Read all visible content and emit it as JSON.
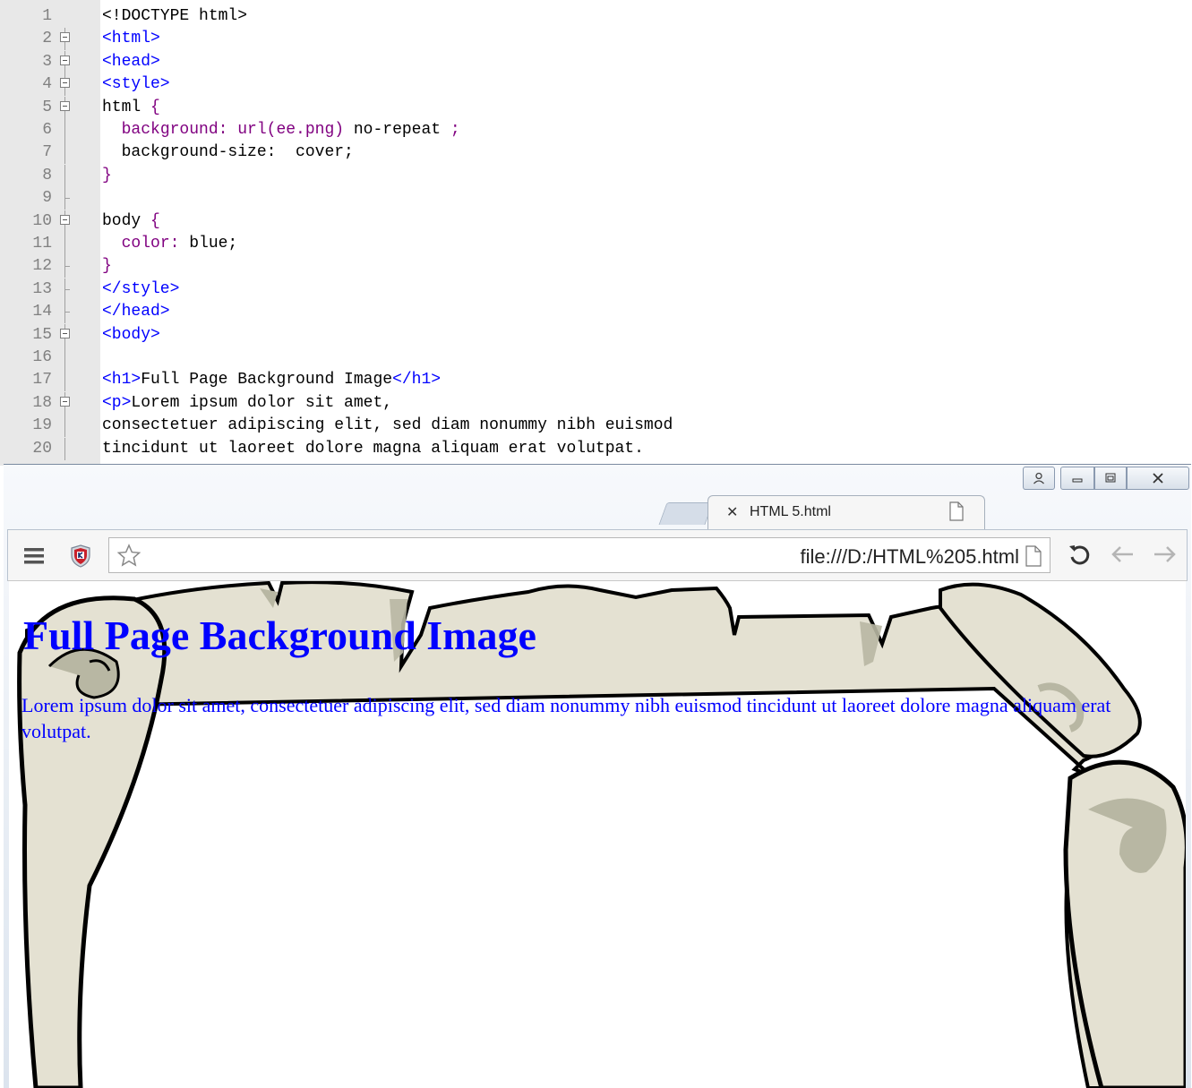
{
  "editor": {
    "lines": [
      {
        "num": "1",
        "fold": "none",
        "segments": [
          {
            "t": "<!DOCTYPE html>",
            "c": "plain"
          }
        ]
      },
      {
        "num": "2",
        "fold": "box",
        "segments": [
          {
            "t": "<html>",
            "c": "tag"
          }
        ]
      },
      {
        "num": "3",
        "fold": "box",
        "segments": [
          {
            "t": "<head>",
            "c": "tag"
          }
        ]
      },
      {
        "num": "4",
        "fold": "box",
        "segments": [
          {
            "t": "<style>",
            "c": "tag"
          }
        ]
      },
      {
        "num": "5",
        "fold": "box",
        "segments": [
          {
            "t": "html ",
            "c": "plain"
          },
          {
            "t": "{",
            "c": "brace"
          }
        ]
      },
      {
        "num": "6",
        "fold": "line",
        "segments": [
          {
            "t": "  ",
            "c": "plain"
          },
          {
            "t": "background: url(ee.png)",
            "c": "prop"
          },
          {
            "t": " no-repeat ",
            "c": "plain"
          },
          {
            "t": ";",
            "c": "prop"
          }
        ]
      },
      {
        "num": "7",
        "fold": "line",
        "segments": [
          {
            "t": "  background-size:  cover;",
            "c": "plain"
          }
        ]
      },
      {
        "num": "8",
        "fold": "line",
        "segments": [
          {
            "t": "}",
            "c": "brace"
          }
        ]
      },
      {
        "num": "9",
        "fold": "tick",
        "segments": [
          {
            "t": "",
            "c": "plain"
          }
        ]
      },
      {
        "num": "10",
        "fold": "box",
        "segments": [
          {
            "t": "body ",
            "c": "plain"
          },
          {
            "t": "{",
            "c": "brace"
          }
        ]
      },
      {
        "num": "11",
        "fold": "line",
        "segments": [
          {
            "t": "  ",
            "c": "plain"
          },
          {
            "t": "color:",
            "c": "prop"
          },
          {
            "t": " blue;",
            "c": "plain"
          }
        ]
      },
      {
        "num": "12",
        "fold": "tick",
        "segments": [
          {
            "t": "}",
            "c": "brace"
          }
        ]
      },
      {
        "num": "13",
        "fold": "tick",
        "segments": [
          {
            "t": "</style>",
            "c": "tag"
          }
        ]
      },
      {
        "num": "14",
        "fold": "tick",
        "segments": [
          {
            "t": "</head>",
            "c": "tag"
          }
        ]
      },
      {
        "num": "15",
        "fold": "box",
        "segments": [
          {
            "t": "<body>",
            "c": "tag"
          }
        ]
      },
      {
        "num": "16",
        "fold": "line",
        "segments": [
          {
            "t": "",
            "c": "plain"
          }
        ]
      },
      {
        "num": "17",
        "fold": "line",
        "segments": [
          {
            "t": "<h1>",
            "c": "tag"
          },
          {
            "t": "Full Page Background Image",
            "c": "plain"
          },
          {
            "t": "</h1>",
            "c": "tag"
          }
        ]
      },
      {
        "num": "18",
        "fold": "box",
        "segments": [
          {
            "t": "<p>",
            "c": "tag"
          },
          {
            "t": "Lorem ipsum dolor sit amet,",
            "c": "plain"
          }
        ]
      },
      {
        "num": "19",
        "fold": "line",
        "segments": [
          {
            "t": "consectetuer adipiscing elit, sed diam nonummy nibh euismod",
            "c": "plain"
          }
        ]
      },
      {
        "num": "20",
        "fold": "line",
        "segments": [
          {
            "t": "tincidunt ut laoreet dolore magna aliquam erat volutpat.",
            "c": "plain"
          }
        ]
      }
    ]
  },
  "browser": {
    "tab_title": "HTML 5.html",
    "url": "file:///D:/HTML%205.html",
    "page": {
      "heading": "Full Page Background Image",
      "paragraph": "Lorem ipsum dolor sit amet, consectetuer adipiscing elit, sed diam nonummy nibh euismod tincidunt ut laoreet dolore magna aliquam erat volutpat."
    }
  },
  "colors": {
    "tag": "#0000ff",
    "css_property": "#800080",
    "page_text": "#0000ff",
    "scroll_fill": "#e4e1d2",
    "scroll_shade": "#b8b7a3"
  }
}
